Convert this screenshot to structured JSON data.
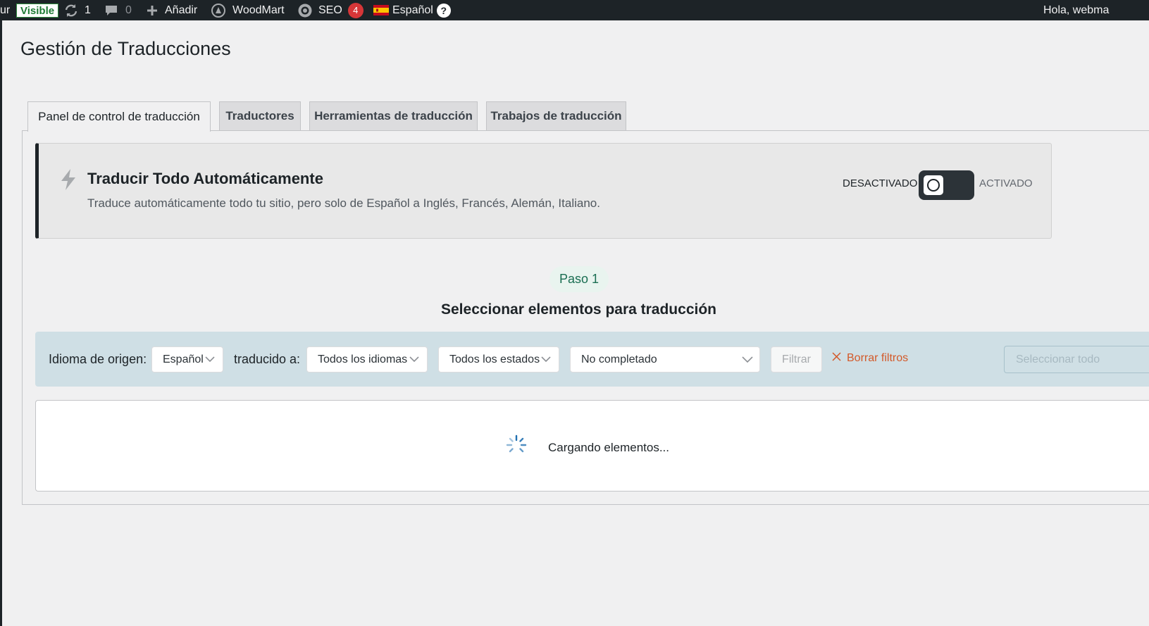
{
  "admin_bar": {
    "partial_left": "ur",
    "visible_badge": "Visible",
    "updates_count": "1",
    "comments_count": "0",
    "add_label": "Añadir",
    "woodmart_label": "WoodMart",
    "seo_label": "SEO",
    "seo_count": "4",
    "language_label": "Español",
    "help_glyph": "?",
    "greeting": "Hola, webma"
  },
  "page": {
    "title": "Gestión de Traducciones"
  },
  "tabs": [
    {
      "label": "Panel de control de traducción",
      "active": true
    },
    {
      "label": "Traductores",
      "active": false
    },
    {
      "label": "Herramientas de traducción",
      "active": false
    },
    {
      "label": "Trabajos de traducción",
      "active": false
    }
  ],
  "auto_translate": {
    "icon": "bolt-icon",
    "title": "Traducir Todo Automáticamente",
    "description": "Traduce automáticamente todo tu sitio, pero solo de Español a Inglés, Francés, Alemán, Italiano.",
    "off_label": "DESACTIVADO",
    "on_label": "ACTIVADO",
    "enabled": false
  },
  "step": {
    "pill": "Paso 1",
    "title": "Seleccionar elementos para traducción"
  },
  "filters": {
    "source_label": "Idioma de origen:",
    "source_value": "Español",
    "target_label": "traducido a:",
    "target_value": "Todos los idiomas",
    "status_value": "Todos los estados",
    "completion_value": "No completado",
    "filter_button": "Filtrar",
    "clear_label": "Borrar filtros",
    "select_all": "Seleccionar todo"
  },
  "items": {
    "loading_text": "Cargando elementos..."
  },
  "colors": {
    "admin_bar": "#1d2327",
    "accent_green": "#1a6e52",
    "filter_bg": "#cfdfe5",
    "clear_red": "#d35a2a",
    "badge_red": "#d63638"
  }
}
